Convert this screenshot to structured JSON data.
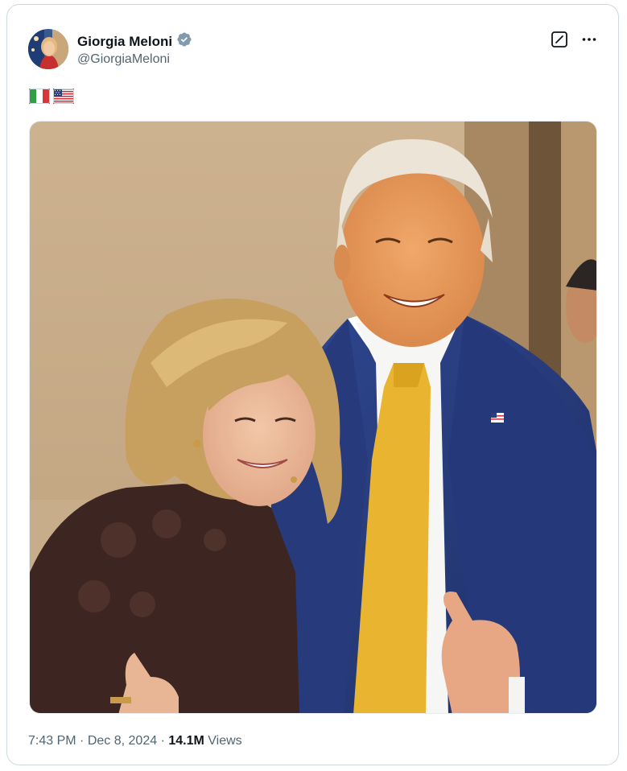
{
  "author": {
    "display_name": "Giorgia Meloni",
    "handle": "@GiorgiaMeloni",
    "verified": true
  },
  "tweet": {
    "flags": [
      "flag-italy-icon",
      "flag-usa-icon"
    ],
    "time": "7:43 PM",
    "separator": "·",
    "date": "Dec 8, 2024",
    "views_count": "14.1M",
    "views_label": "Views"
  },
  "icons": {
    "verified": "verified-badge-icon",
    "grok": "grok-icon",
    "more": "more-icon"
  },
  "colors": {
    "text_primary": "#0f1419",
    "text_secondary": "#536471",
    "border": "#cfd9de",
    "verified_badge": "#829aab",
    "tie": "#e9b531",
    "suit": "#2a3f86"
  }
}
